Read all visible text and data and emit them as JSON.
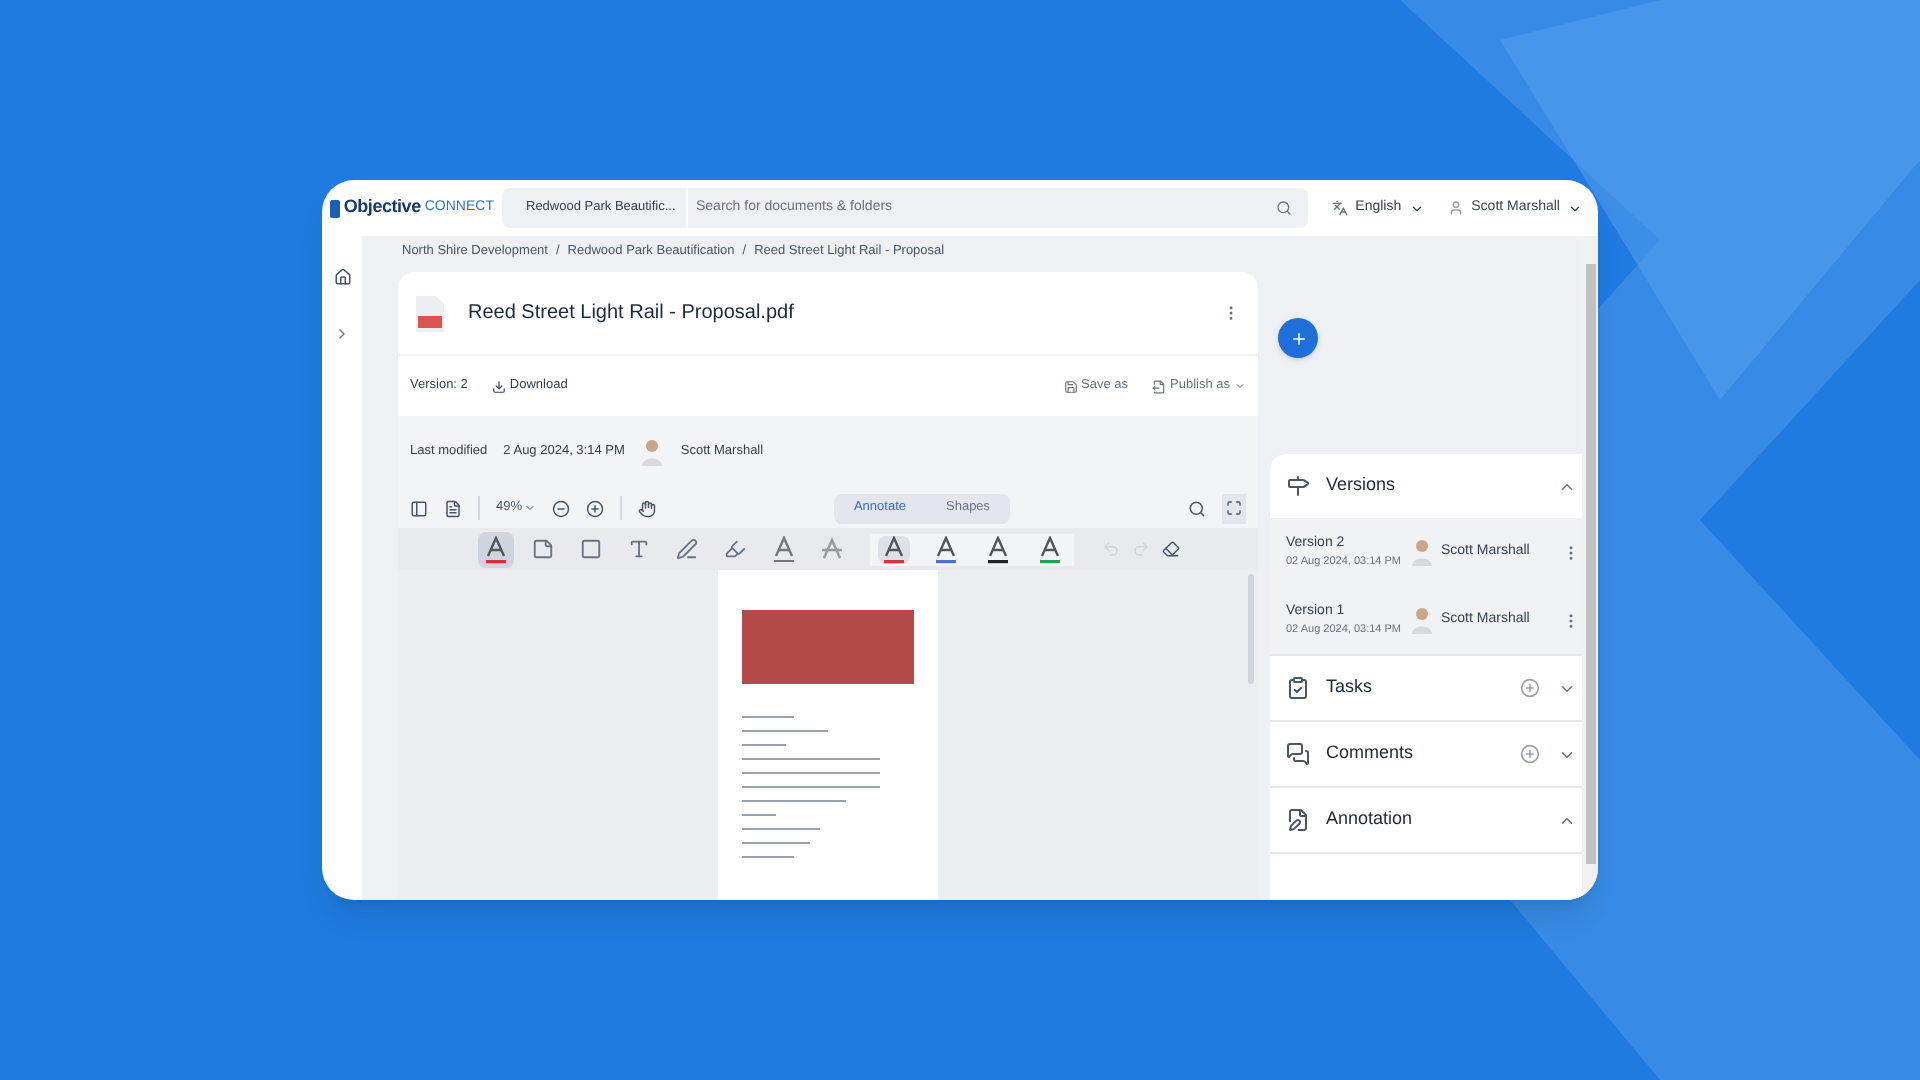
{
  "header": {
    "logo_bold": "Objective",
    "logo_light": "CONNECT",
    "folder": "Redwood Park Beautific...",
    "search": {
      "placeholder": "Search for documents & folders"
    },
    "language": "English",
    "user": "Scott Marshall"
  },
  "breadcrumb_separator": "/",
  "breadcrumbs": [
    "North Shire Development",
    "Redwood Park Beautification",
    "Reed Street Light Rail - Proposal"
  ],
  "document": {
    "title": "Reed Street Light Rail - Proposal.pdf",
    "version": "Version: 2",
    "download": "Download",
    "save_as": "Save as",
    "publish_as": "Publish as",
    "last_modified_label": "Last modified",
    "last_modified": "2 Aug 2024, 3:14 PM",
    "modified_by": "Scott Marshall"
  },
  "viewer": {
    "zoom": "49%",
    "tabs": [
      {
        "label": "Annotate",
        "selected": true
      },
      {
        "label": "Shapes",
        "selected": false
      }
    ],
    "tools": [
      {
        "kind": "text-color",
        "selected": true
      },
      {
        "kind": "note",
        "selected": false
      },
      {
        "kind": "rectangle",
        "selected": false
      },
      {
        "kind": "text",
        "selected": false
      },
      {
        "kind": "pen",
        "selected": false
      },
      {
        "kind": "highlighter",
        "selected": false
      },
      {
        "kind": "underline",
        "selected": false
      },
      {
        "kind": "strikeout",
        "selected": false
      }
    ],
    "colors": [
      {
        "color": "#d13438",
        "selected": true
      },
      {
        "color": "#4a6fd6",
        "selected": false
      },
      {
        "color": "#222222",
        "selected": false
      },
      {
        "color": "#2e9e4f",
        "selected": false
      }
    ]
  },
  "panel": {
    "sections": [
      {
        "kind": "versions",
        "title": "Versions",
        "expanded": true,
        "add": false
      },
      {
        "kind": "tasks",
        "title": "Tasks",
        "expanded": false,
        "add": true
      },
      {
        "kind": "comments",
        "title": "Comments",
        "expanded": false,
        "add": true
      },
      {
        "kind": "annotation",
        "title": "Annotation",
        "expanded": true,
        "add": false
      }
    ],
    "versions": [
      {
        "name": "Version 2",
        "date": "02 Aug 2024, 03:14 PM",
        "user": "Scott Marshall"
      },
      {
        "name": "Version 1",
        "date": "02 Aug 2024, 03:14 PM",
        "user": "Scott Marshall"
      }
    ]
  }
}
